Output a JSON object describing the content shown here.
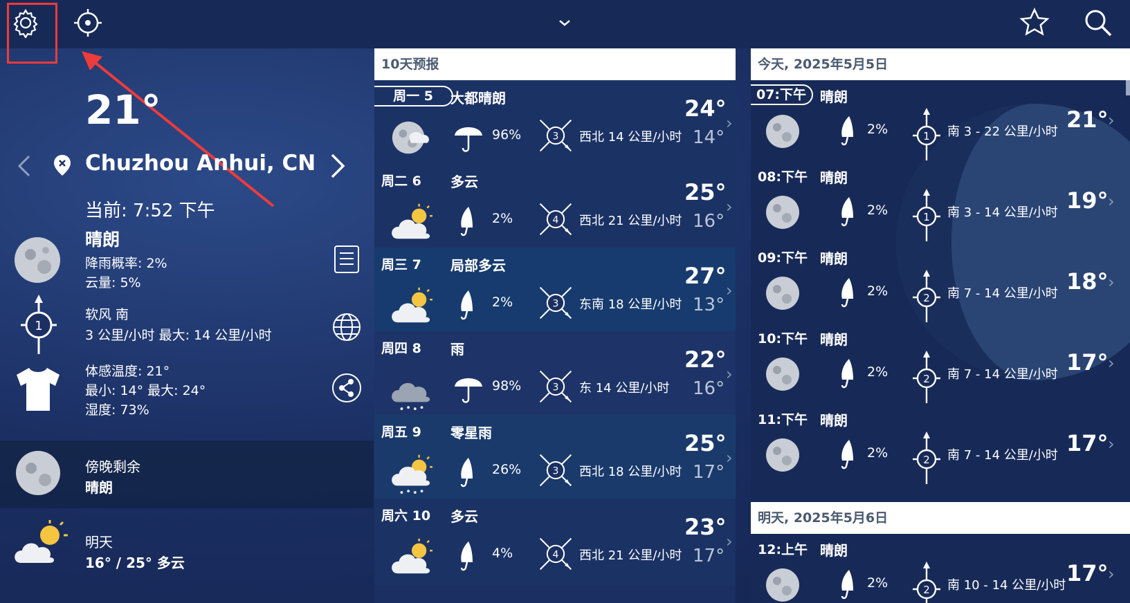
{
  "header": {
    "icons": [
      "gear-icon",
      "locate-icon",
      "chevron-down-icon",
      "star-icon",
      "search-icon"
    ]
  },
  "current": {
    "temp": "21°",
    "location": "Chuzhou Anhui, CN",
    "time": "当前: 7:52 下午",
    "condition": "晴朗",
    "rain_chance": "降雨概率: 2%",
    "cloud": "云量: 5%",
    "wind_desc": "软风 南",
    "wind_speed": "3 公里/小时 最大: 14 公里/小时",
    "wind_level": "1",
    "feels_like": "体感温度: 21°",
    "min_max": "最小: 14° 最大: 24°",
    "humidity": "湿度: 73%",
    "dusk_label": "傍晚剩余",
    "dusk_cond": "晴朗",
    "tomorrow_label": "明天",
    "tomorrow_cond": "16° / 25° 多云"
  },
  "forecast": {
    "title": "10天预报",
    "days": [
      {
        "day": "周一 5",
        "cond": "大都晴朗",
        "pct": "96%",
        "wind": "西北 14 公里/小时",
        "lvl": "3",
        "hi": "24°",
        "lo": "14°",
        "icon": "moon-cloud",
        "umb": "open"
      },
      {
        "day": "周二 6",
        "cond": "多云",
        "pct": "2%",
        "wind": "西北 21 公里/小时",
        "lvl": "4",
        "hi": "25°",
        "lo": "16°",
        "icon": "sun-cloud",
        "umb": "closed"
      },
      {
        "day": "周三 7",
        "cond": "局部多云",
        "pct": "2%",
        "wind": "东南 18 公里/小时",
        "lvl": "3",
        "hi": "27°",
        "lo": "13°",
        "icon": "sun-cloud",
        "umb": "closed"
      },
      {
        "day": "周四 8",
        "cond": "雨",
        "pct": "98%",
        "wind": "东 14 公里/小时",
        "lvl": "3",
        "hi": "22°",
        "lo": "16°",
        "icon": "rain-cloud",
        "umb": "open"
      },
      {
        "day": "周五 9",
        "cond": "零星雨",
        "pct": "26%",
        "wind": "西北 18 公里/小时",
        "lvl": "3",
        "hi": "25°",
        "lo": "17°",
        "icon": "sun-rain",
        "umb": "closed"
      },
      {
        "day": "周六 10",
        "cond": "多云",
        "pct": "4%",
        "wind": "西北 21 公里/小时",
        "lvl": "4",
        "hi": "23°",
        "lo": "17°",
        "icon": "sun-cloud",
        "umb": "closed"
      }
    ]
  },
  "hourly": {
    "today_title": "今天, 2025年5月5日",
    "tomorrow_title": "明天, 2025年5月6日",
    "hours": [
      {
        "time": "07:下午",
        "cond": "晴朗",
        "pct": "2%",
        "lvl": "1",
        "wind": "南 3 - 22 公里/小时",
        "temp": "21°"
      },
      {
        "time": "08:下午",
        "cond": "晴朗",
        "pct": "2%",
        "lvl": "1",
        "wind": "南 3 - 14 公里/小时",
        "temp": "19°"
      },
      {
        "time": "09:下午",
        "cond": "晴朗",
        "pct": "2%",
        "lvl": "2",
        "wind": "南 7 - 14 公里/小时",
        "temp": "18°"
      },
      {
        "time": "10:下午",
        "cond": "晴朗",
        "pct": "2%",
        "lvl": "2",
        "wind": "南 7 - 14 公里/小时",
        "temp": "17°"
      },
      {
        "time": "11:下午",
        "cond": "晴朗",
        "pct": "2%",
        "lvl": "2",
        "wind": "南 7 - 14 公里/小时",
        "temp": "17°"
      }
    ],
    "tomorrow_hours": [
      {
        "time": "12:上午",
        "cond": "晴朗",
        "pct": "2%",
        "lvl": "2",
        "wind": "南 10 - 14 公里/小时",
        "temp": "17°"
      }
    ]
  },
  "colors": {
    "highlight": "#ee3b3b",
    "bg": "#1b2f63",
    "header_text": "#4a5a70"
  }
}
